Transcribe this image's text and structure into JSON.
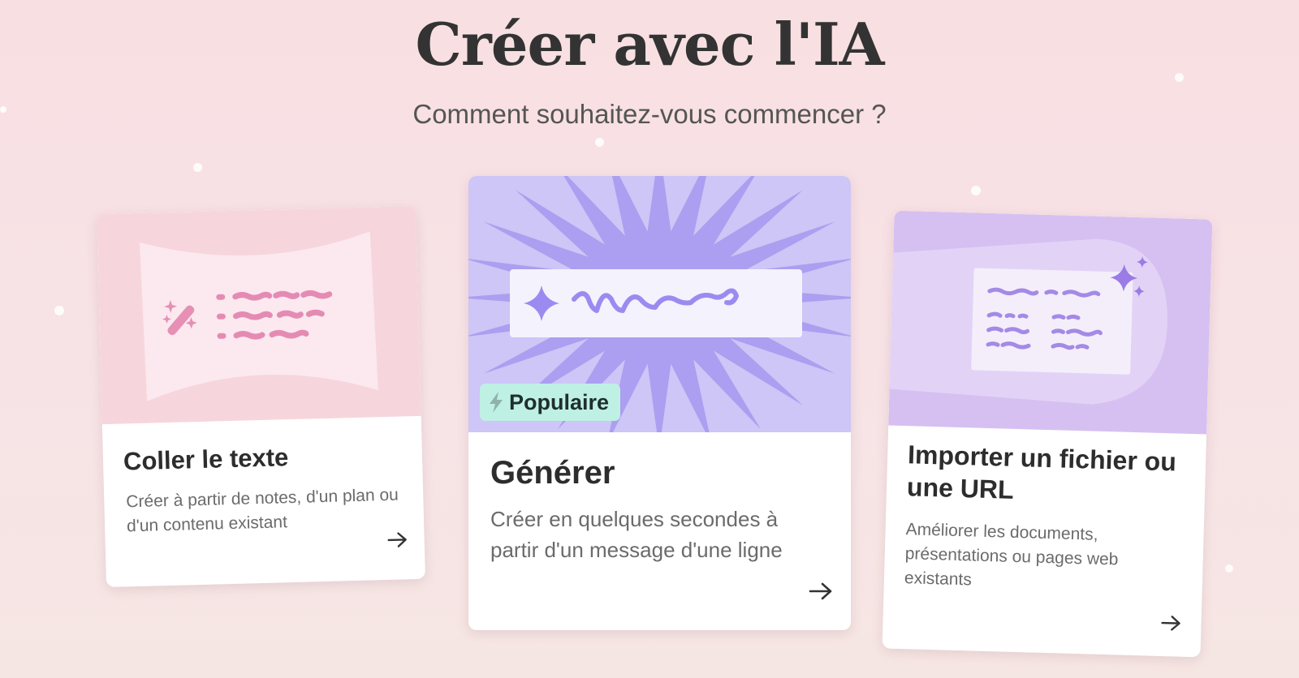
{
  "header": {
    "title": "Créer avec l'IA",
    "subtitle": "Comment souhaitez-vous commencer ?"
  },
  "cards": [
    {
      "id": "paste",
      "title": "Coller le texte",
      "description": "Créer à partir de notes, d'un plan ou d'un contenu existant",
      "icon": "magic-wand-icon",
      "art_color": "#f6d6dc"
    },
    {
      "id": "generate",
      "title": "Générer",
      "description": "Créer en quelques secondes à partir d'un message d'une ligne",
      "badge": "Populaire",
      "badge_icon": "lightning-icon",
      "icon": "sparkle-icon",
      "art_color": "#cdc6f6"
    },
    {
      "id": "import",
      "title": "Importer un fichier ou une URL",
      "description": "Améliorer les documents, présentations ou pages web existants",
      "icon": "sparkles-icon",
      "art_color": "#d6c0f1"
    }
  ],
  "colors": {
    "badge_bg": "#bff0e4",
    "accent_purple": "#9b8bf0",
    "accent_pink": "#e78fb5"
  }
}
